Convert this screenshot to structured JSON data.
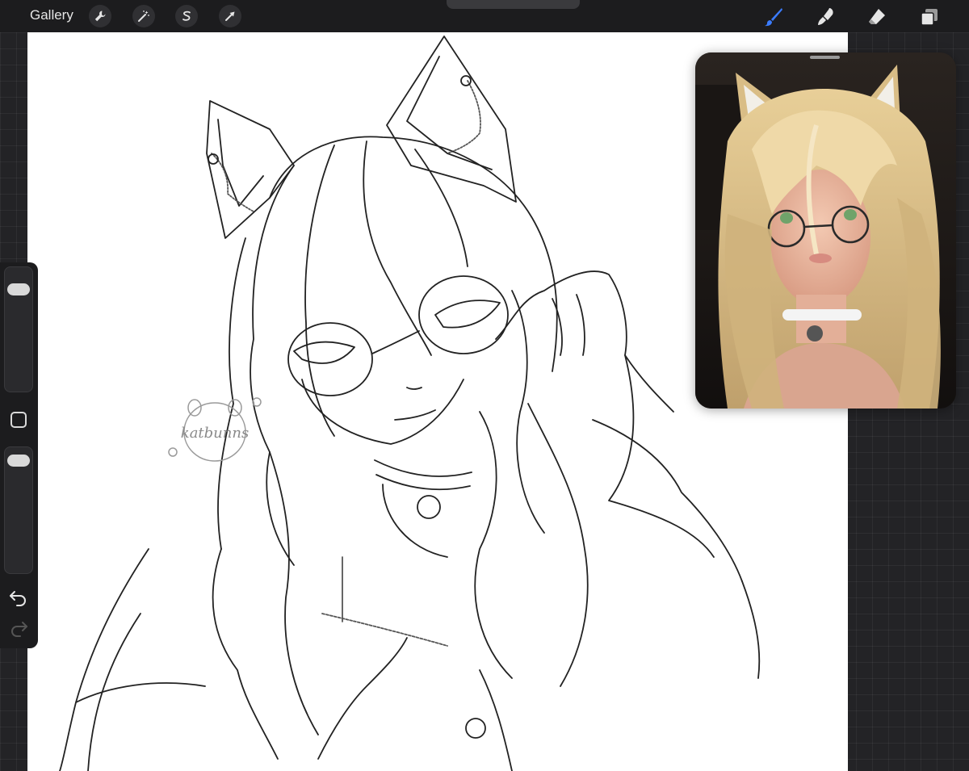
{
  "toolbar": {
    "gallery_label": "Gallery",
    "left_tools": [
      "wrench-icon",
      "magic-wand-icon",
      "selection-s-icon",
      "arrow-cursor-icon"
    ],
    "right_tools": [
      "brush-icon",
      "smudge-icon",
      "eraser-icon",
      "layers-icon"
    ],
    "accent_color": "#3b7cff"
  },
  "canvas": {
    "watermark_text": "katbunns"
  },
  "sidebar": {
    "brush_size": 0.88,
    "opacity": 0.96,
    "controls": [
      "modify-button",
      "undo-icon",
      "redo-icon"
    ]
  }
}
